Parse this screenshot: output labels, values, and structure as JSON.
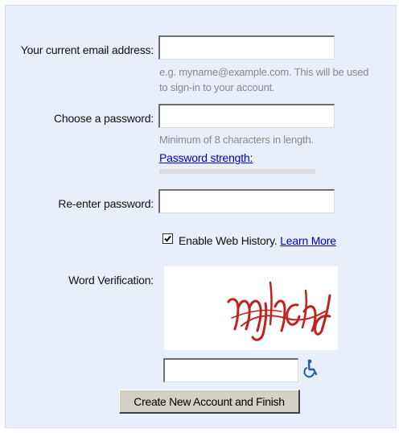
{
  "form": {
    "email": {
      "label": "Your current email address:",
      "value": "",
      "hint_line1": "e.g. myname@example.com. This will be used",
      "hint_line2": "to sign-in to your account."
    },
    "password": {
      "label": "Choose a password:",
      "value": "",
      "hint": "Minimum of 8 characters in length.",
      "strength_link": "Password strength:",
      "strength_level": 0
    },
    "reenter": {
      "label": "Re-enter password:",
      "value": ""
    },
    "web_history": {
      "checked": true,
      "label": "Enable Web History.",
      "learn_more": "Learn More"
    },
    "verification": {
      "label": "Word Verification:",
      "captcha_word": "mjincind",
      "value": "",
      "accessibility_icon": "wheelchair-icon"
    },
    "submit_label": "Create New Account and Finish"
  },
  "colors": {
    "panel": "#e8eefa",
    "link": "#0000cc",
    "hint": "#8a8a8a",
    "captcha_ink": "#c0231e",
    "accessibility": "#1a5fb4"
  }
}
